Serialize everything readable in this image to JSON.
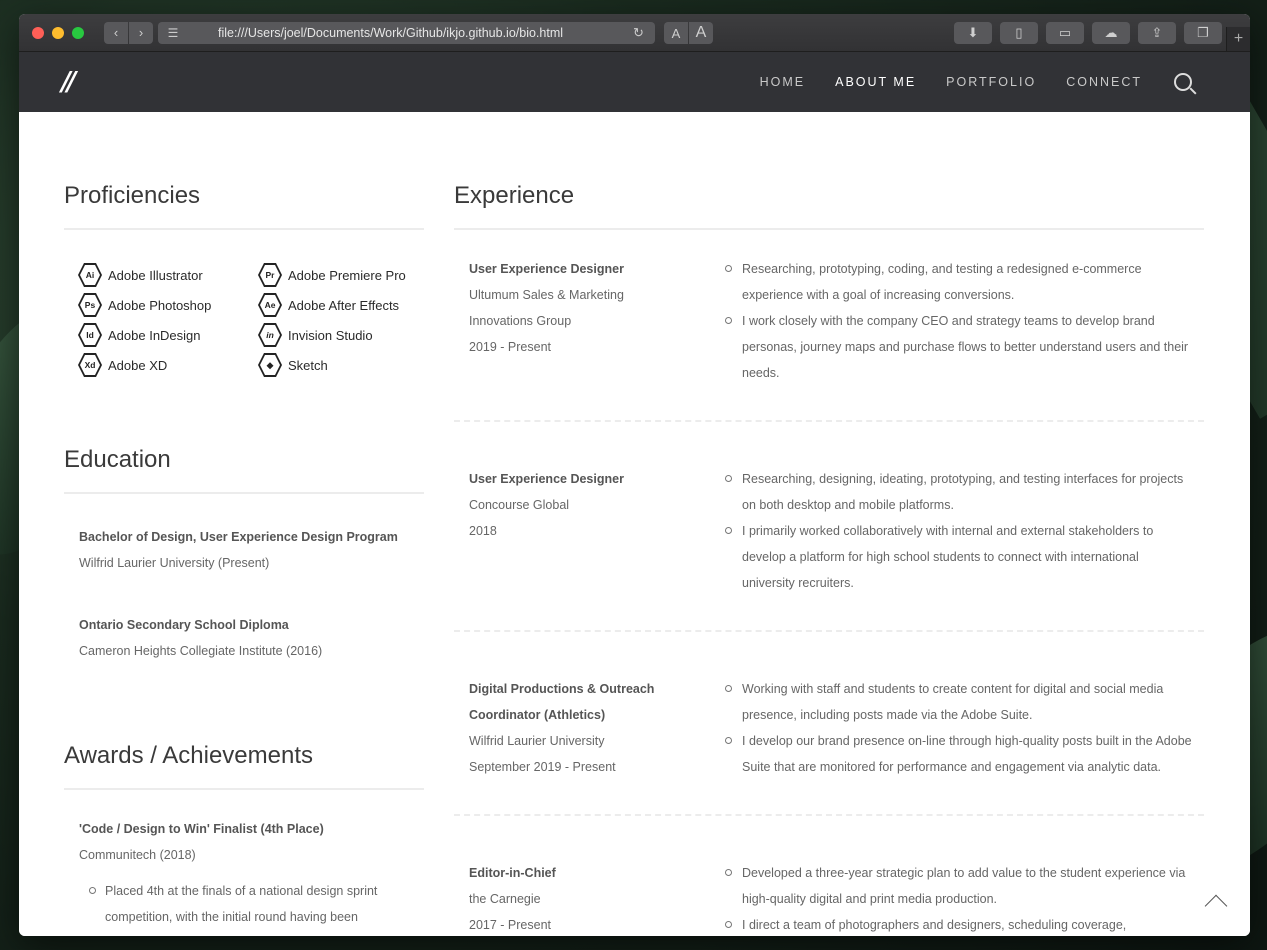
{
  "browser": {
    "url": "file:///Users/joel/Documents/Work/Github/ikjo.github.io/bio.html",
    "font_small": "A",
    "font_large": "A"
  },
  "site": {
    "logo": "//",
    "nav": [
      "HOME",
      "ABOUT ME",
      "PORTFOLIO",
      "CONNECT"
    ],
    "active_nav": "ABOUT ME"
  },
  "proficiencies": {
    "title": "Proficiencies",
    "items": [
      {
        "abbr": "Ai",
        "label": "Adobe Illustrator"
      },
      {
        "abbr": "Pr",
        "label": "Adobe Premiere Pro"
      },
      {
        "abbr": "Ps",
        "label": "Adobe Photoshop"
      },
      {
        "abbr": "Ae",
        "label": "Adobe After Effects"
      },
      {
        "abbr": "Id",
        "label": "Adobe InDesign"
      },
      {
        "abbr": "in",
        "label": "Invision Studio"
      },
      {
        "abbr": "Xd",
        "label": "Adobe XD"
      },
      {
        "abbr": "◆",
        "label": "Sketch"
      }
    ]
  },
  "education": {
    "title": "Education",
    "items": [
      {
        "title": "Bachelor of Design, User Experience Design Program",
        "sub": "Wilfrid Laurier University (Present)"
      },
      {
        "title": "Ontario Secondary School Diploma",
        "sub": "Cameron Heights Collegiate Institute (2016)"
      }
    ]
  },
  "awards": {
    "title": "Awards / Achievements",
    "items": [
      {
        "title": "'Code / Design to Win' Finalist (4th Place)",
        "sub": "Communitech (2018)",
        "bullet": "Placed 4th at the finals of a national design sprint competition, with the initial round having been"
      }
    ]
  },
  "experience": {
    "title": "Experience",
    "items": [
      {
        "role": "User Experience Designer",
        "lines": [
          "Ultumum Sales & Marketing",
          "Innovations Group",
          "2019 - Present"
        ],
        "bullets": [
          "Researching, prototyping, coding, and testing a redesigned e-commerce experience with a goal of increasing conversions.",
          "I work closely with the company CEO and strategy teams to develop brand personas, journey maps and purchase flows to better understand users and their needs."
        ]
      },
      {
        "role": "User Experience Designer",
        "lines": [
          "Concourse Global",
          "2018"
        ],
        "bullets": [
          "Researching, designing, ideating, prototyping, and testing interfaces for projects on both desktop and mobile platforms.",
          "I primarily worked collaboratively with internal and external stakeholders to develop a platform for high school students to connect with international university recruiters."
        ]
      },
      {
        "role": "Digital Productions & Outreach Coordinator (Athletics)",
        "lines": [
          "Wilfrid Laurier University",
          "September 2019 - Present"
        ],
        "bullets": [
          "Working with staff and students to create content for digital and social media presence, including posts made via the Adobe Suite.",
          "I develop our brand presence on-line through high-quality posts built in the Adobe Suite that are monitored for performance and engagement via analytic data."
        ]
      },
      {
        "role": "Editor-in-Chief",
        "lines": [
          "the Carnegie",
          "2017 - Present"
        ],
        "bullets": [
          "Developed a three-year strategic plan to add value to the student experience via high-quality digital and print media production.",
          "I direct a team of photographers and designers, scheduling coverage,"
        ]
      }
    ]
  }
}
